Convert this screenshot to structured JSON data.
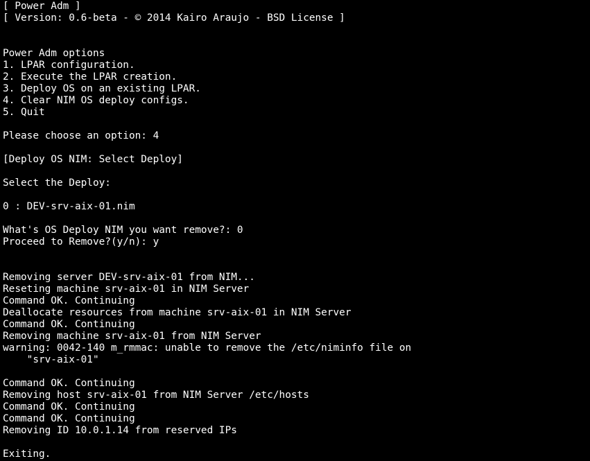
{
  "colors": {
    "background": "#000000",
    "foreground": "#ffffff"
  },
  "lines": [
    "[ Power Adm ]",
    "[ Version: 0.6-beta - © 2014 Kairo Araujo - BSD License ]",
    "",
    "",
    "Power Adm options",
    "1. LPAR configuration.",
    "2. Execute the LPAR creation.",
    "3. Deploy OS on an existing LPAR.",
    "4. Clear NIM OS deploy configs.",
    "5. Quit",
    "",
    "Please choose an option: 4",
    "",
    "[Deploy OS NIM: Select Deploy]",
    "",
    "Select the Deploy:",
    "",
    "0 : DEV-srv-aix-01.nim",
    "",
    "What's OS Deploy NIM you want remove?: 0",
    "Proceed to Remove?(y/n): y",
    "",
    "",
    "Removing server DEV-srv-aix-01 from NIM...",
    "Reseting machine srv-aix-01 in NIM Server",
    "Command OK. Continuing",
    "Deallocate resources from machine srv-aix-01 in NIM Server",
    "Command OK. Continuing",
    "Removing machine srv-aix-01 from NIM Server",
    "warning: 0042-140 m_rmmac: unable to remove the /etc/niminfo file on",
    "    \"srv-aix-01\"",
    "",
    "Command OK. Continuing",
    "Removing host srv-aix-01 from NIM Server /etc/hosts",
    "Command OK. Continuing",
    "Command OK. Continuing",
    "Removing ID 10.0.1.14 from reserved IPs",
    "",
    "Exiting."
  ]
}
